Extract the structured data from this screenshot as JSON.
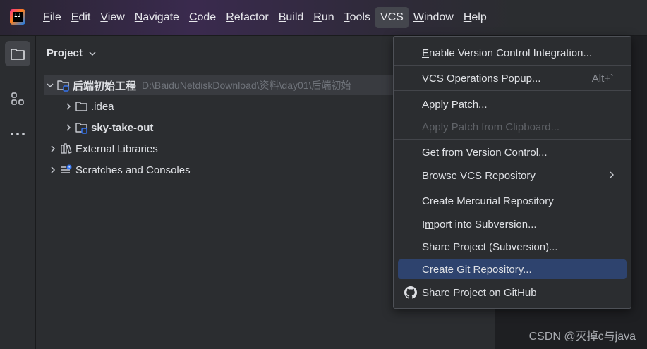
{
  "app": {
    "logo_text": "IJ"
  },
  "menu": [
    {
      "mnemonic": "F",
      "rest": "ile"
    },
    {
      "mnemonic": "E",
      "rest": "dit"
    },
    {
      "mnemonic": "V",
      "rest": "iew"
    },
    {
      "mnemonic": "N",
      "rest": "avigate"
    },
    {
      "mnemonic": "C",
      "rest": "ode"
    },
    {
      "mnemonic": "R",
      "rest": "efactor"
    },
    {
      "mnemonic": "B",
      "rest": "uild"
    },
    {
      "mnemonic": "R",
      "rest": "un"
    },
    {
      "mnemonic": "T",
      "rest": "ools"
    },
    {
      "label": "VCS"
    },
    {
      "mnemonic": "W",
      "rest": "indow"
    },
    {
      "mnemonic": "H",
      "rest": "elp"
    }
  ],
  "sidebar": {
    "icons": [
      "project-folder-icon",
      "structure-icon",
      "more-icon"
    ]
  },
  "project_panel": {
    "title": "Project",
    "tree": [
      {
        "label": "后端初始工程",
        "path": "D:\\BaiduNetdiskDownload\\资料\\day01\\后端初始"
      },
      {
        "label": ".idea"
      },
      {
        "label": "sky-take-out"
      },
      {
        "label": "External Libraries"
      },
      {
        "label": "Scratches and Consoles"
      }
    ]
  },
  "vcs_menu": {
    "items": [
      {
        "mnemonic": "E",
        "rest": "nable Version Control Integration..."
      },
      {
        "label": "VCS Operations Popup...",
        "shortcut": "Alt+`"
      },
      {
        "label": "Apply Patch..."
      },
      {
        "label": "Apply Patch from Clipboard...",
        "disabled": true
      },
      {
        "label": "Get from Version Control..."
      },
      {
        "label": "Browse VCS Repository",
        "submenu": "›"
      },
      {
        "label": "Create Mercurial Repository"
      },
      {
        "pre": "I",
        "mnemonic": "m",
        "rest": "port into Subversion..."
      },
      {
        "label": "Share Project (Subversion)..."
      },
      {
        "label": "Create Git Repository...",
        "highlighted": true
      },
      {
        "label": "Share Project on GitHub"
      }
    ]
  },
  "watermark": "CSDN @灭掉c与java",
  "colors": {
    "highlight": "#2e436e",
    "accent": "#3574f0",
    "background": "#1e1f22",
    "panel": "#2b2d30"
  }
}
